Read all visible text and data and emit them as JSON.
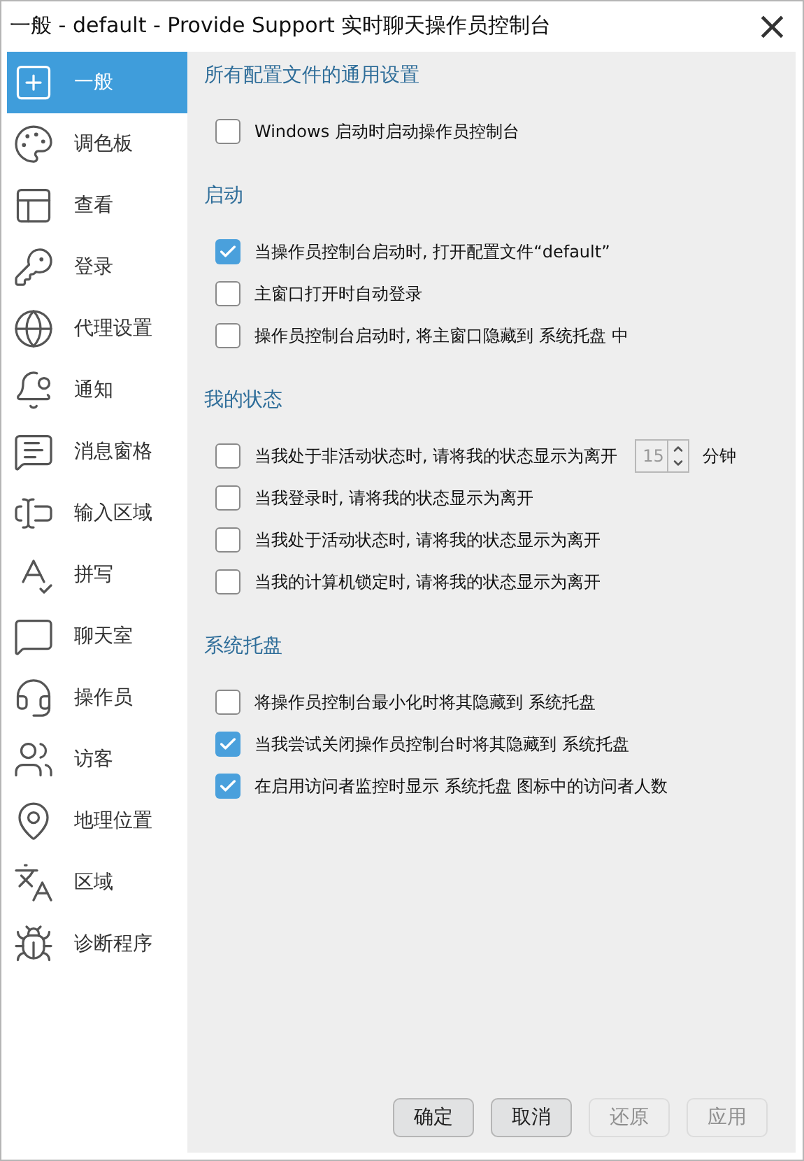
{
  "window": {
    "title": "一般 - default - Provide Support 实时聊天操作员控制台",
    "close": "×"
  },
  "sidebar": {
    "items": [
      {
        "label": "一般",
        "selected": true
      },
      {
        "label": "调色板",
        "selected": false
      },
      {
        "label": "查看",
        "selected": false
      },
      {
        "label": "登录",
        "selected": false
      },
      {
        "label": "代理设置",
        "selected": false
      },
      {
        "label": "通知",
        "selected": false
      },
      {
        "label": "消息窗格",
        "selected": false
      },
      {
        "label": "输入区域",
        "selected": false
      },
      {
        "label": "拼写",
        "selected": false
      },
      {
        "label": "聊天室",
        "selected": false
      },
      {
        "label": "操作员",
        "selected": false
      },
      {
        "label": "访客",
        "selected": false
      },
      {
        "label": "地理位置",
        "selected": false
      },
      {
        "label": "区域",
        "selected": false
      },
      {
        "label": "诊断程序",
        "selected": false
      }
    ]
  },
  "sections": [
    {
      "title": "所有配置文件的通用设置",
      "options": [
        {
          "kind": "checkbox",
          "label": "Windows 启动时启动操作员控制台",
          "checked": false
        }
      ]
    },
    {
      "title": "启动",
      "options": [
        {
          "kind": "checkbox",
          "label": "当操作员控制台启动时, 打开配置文件“default”",
          "checked": true
        },
        {
          "kind": "checkbox",
          "label": "主窗口打开时自动登录",
          "checked": false
        },
        {
          "kind": "checkbox",
          "label": "操作员控制台启动时, 将主窗口隐藏到 系统托盘 中",
          "checked": false
        }
      ]
    },
    {
      "title": "我的状态",
      "options": [
        {
          "kind": "spinner",
          "label": "当我处于非活动状态时, 请将我的状态显示为离开",
          "checked": false,
          "value": "15",
          "unit": "分钟",
          "disabled": true
        },
        {
          "kind": "checkbox",
          "label": "当我登录时, 请将我的状态显示为离开",
          "checked": false
        },
        {
          "kind": "checkbox",
          "label": "当我处于活动状态时, 请将我的状态显示为离开",
          "checked": false
        },
        {
          "kind": "checkbox",
          "label": "当我的计算机锁定时, 请将我的状态显示为离开",
          "checked": false
        }
      ]
    },
    {
      "title": "系统托盘",
      "options": [
        {
          "kind": "checkbox",
          "label": "将操作员控制台最小化时将其隐藏到 系统托盘",
          "checked": false
        },
        {
          "kind": "checkbox",
          "label": "当我尝试关闭操作员控制台时将其隐藏到 系统托盘",
          "checked": true
        },
        {
          "kind": "checkbox",
          "label": "在启用访问者监控时显示 系统托盘 图标中的访问者人数",
          "checked": true
        }
      ]
    }
  ],
  "buttons": [
    {
      "label": "确定",
      "disabled": false
    },
    {
      "label": "取消",
      "disabled": false
    },
    {
      "label": "还原",
      "disabled": true
    },
    {
      "label": "应用",
      "disabled": true
    }
  ]
}
